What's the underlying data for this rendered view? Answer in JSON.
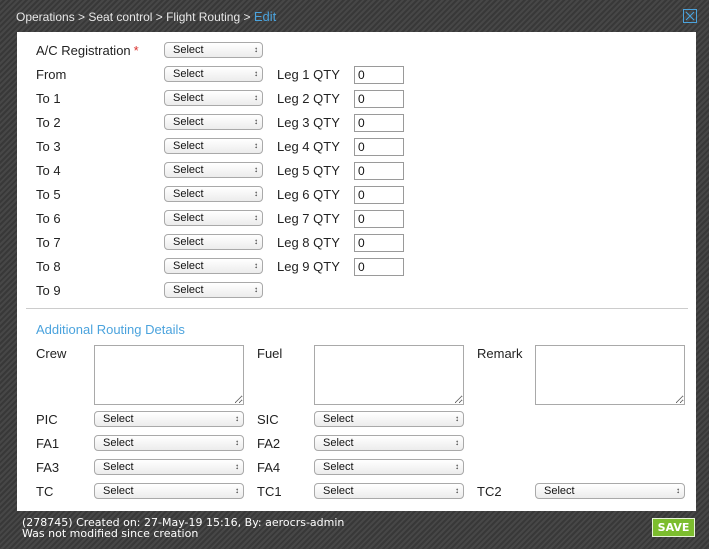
{
  "breadcrumb": {
    "path": "Operations > Seat control > Flight Routing > ",
    "current": "Edit"
  },
  "routing": {
    "registration_label": "A/C Registration",
    "required_mark": "*",
    "registration_value": "Select",
    "rows": [
      {
        "label": "From",
        "value": "Select",
        "leg_label": "Leg 1 QTY",
        "leg_value": "0"
      },
      {
        "label": "To 1",
        "value": "Select",
        "leg_label": "Leg 2 QTY",
        "leg_value": "0"
      },
      {
        "label": "To 2",
        "value": "Select",
        "leg_label": "Leg 3 QTY",
        "leg_value": "0"
      },
      {
        "label": "To 3",
        "value": "Select",
        "leg_label": "Leg 4 QTY",
        "leg_value": "0"
      },
      {
        "label": "To 4",
        "value": "Select",
        "leg_label": "Leg 5 QTY",
        "leg_value": "0"
      },
      {
        "label": "To 5",
        "value": "Select",
        "leg_label": "Leg 6 QTY",
        "leg_value": "0"
      },
      {
        "label": "To 6",
        "value": "Select",
        "leg_label": "Leg 7 QTY",
        "leg_value": "0"
      },
      {
        "label": "To 7",
        "value": "Select",
        "leg_label": "Leg 8 QTY",
        "leg_value": "0"
      },
      {
        "label": "To 8",
        "value": "Select",
        "leg_label": "Leg 9 QTY",
        "leg_value": "0"
      },
      {
        "label": "To 9",
        "value": "Select"
      }
    ]
  },
  "additional": {
    "title": "Additional Routing Details",
    "crew_label": "Crew",
    "fuel_label": "Fuel",
    "remark_label": "Remark",
    "pic_label": "PIC",
    "pic_value": "Select",
    "sic_label": "SIC",
    "sic_value": "Select",
    "fa1_label": "FA1",
    "fa1_value": "Select",
    "fa2_label": "FA2",
    "fa2_value": "Select",
    "fa3_label": "FA3",
    "fa3_value": "Select",
    "fa4_label": "FA4",
    "fa4_value": "Select",
    "tc_label": "TC",
    "tc_value": "Select",
    "tc1_label": "TC1",
    "tc1_value": "Select",
    "tc2_label": "TC2",
    "tc2_value": "Select"
  },
  "footer": {
    "created": "(278745) Created on: 27-May-19 15:16, By: aerocrs-admin",
    "modified": "Was not modified since creation",
    "save_label": "SAVE"
  },
  "colors": {
    "accent": "#4ba3dd",
    "required": "#d9302c",
    "save": "#7cbd2e"
  },
  "icons": {
    "close": "close-icon",
    "dropdown": "updown-arrow-icon"
  }
}
